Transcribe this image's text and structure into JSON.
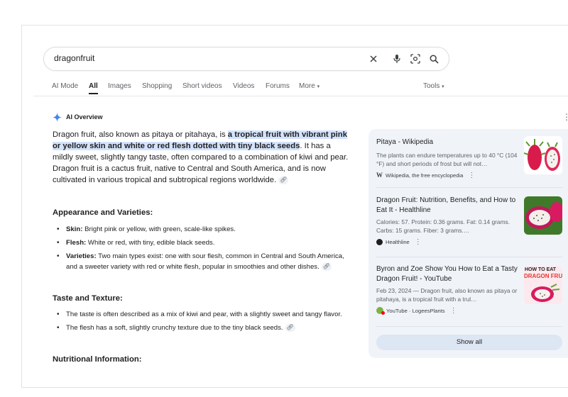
{
  "search": {
    "query": "dragonfruit"
  },
  "tabs": [
    {
      "label": "AI Mode",
      "active": false
    },
    {
      "label": "All",
      "active": true
    },
    {
      "label": "Images",
      "active": false
    },
    {
      "label": "Shopping",
      "active": false
    },
    {
      "label": "Short videos",
      "active": false
    },
    {
      "label": "Videos",
      "active": false
    },
    {
      "label": "Forums",
      "active": false
    },
    {
      "label": "More",
      "active": false
    }
  ],
  "tools_label": "Tools",
  "ai_overview": {
    "label": "AI Overview",
    "intro_start": "Dragon fruit, also known as pitaya or pitahaya, is ",
    "intro_highlight": "a tropical fruit with vibrant pink or yellow skin and white or red flesh dotted with tiny black seeds",
    "intro_end": ". It has a mildly sweet, slightly tangy taste, often compared to a combination of kiwi and pear. Dragon fruit is a cactus fruit, native to Central and South America, and is now cultivated in various tropical and subtropical regions worldwide.",
    "sections": [
      {
        "heading": "Appearance and Varieties:",
        "items": [
          {
            "term": "Skin:",
            "text": " Bright pink or yellow, with green, scale-like spikes."
          },
          {
            "term": "Flesh:",
            "text": " White or red, with tiny, edible black seeds."
          },
          {
            "term": "Varieties:",
            "text": " Two main types exist: one with sour flesh, common in Central and South America, and a sweeter variety with red or white flesh, popular in smoothies and other dishes."
          }
        ]
      },
      {
        "heading": "Taste and Texture:",
        "items": [
          {
            "term": "",
            "text": "The taste is often described as a mix of kiwi and pear, with a slightly sweet and tangy flavor."
          },
          {
            "term": "",
            "text": "The flesh has a soft, slightly crunchy texture due to the tiny black seeds."
          }
        ]
      },
      {
        "heading": "Nutritional Information:",
        "items": []
      }
    ]
  },
  "sources": [
    {
      "title": "Pitaya - Wikipedia",
      "snippet": "The plants can endure temperatures up to 40 °C (104 °F) and short periods of frost but will not…",
      "source": "Wikipedia, the free encyclopedia",
      "source_icon": "W"
    },
    {
      "title": "Dragon Fruit: Nutrition, Benefits, and How to Eat It - Healthline",
      "snippet": "Calories: 57. Protein: 0.36 grams. Fat: 0.14 grams. Carbs: 15 grams. Fiber: 3 grams.…",
      "source": "Healthline",
      "source_icon": "healthline-icon"
    },
    {
      "title": "Byron and Zoe Show You How to Eat a Tasty Dragon Fruit! - YouTube",
      "snippet": "Feb 23, 2024 — Dragon fruit, also known as pitaya or pitahaya, is a tropical fruit with a trul…",
      "source": "YouTube · LogeesPlants",
      "source_icon": "youtube-channel-icon",
      "thumb_text_1": "HOW TO EAT",
      "thumb_text_2": "DRAGON FRUI"
    }
  ],
  "show_all_label": "Show all",
  "colors": {
    "highlight": "#d3e3fd",
    "panel_bg": "#f0f4f9",
    "ai_blue": "#4285f4"
  }
}
